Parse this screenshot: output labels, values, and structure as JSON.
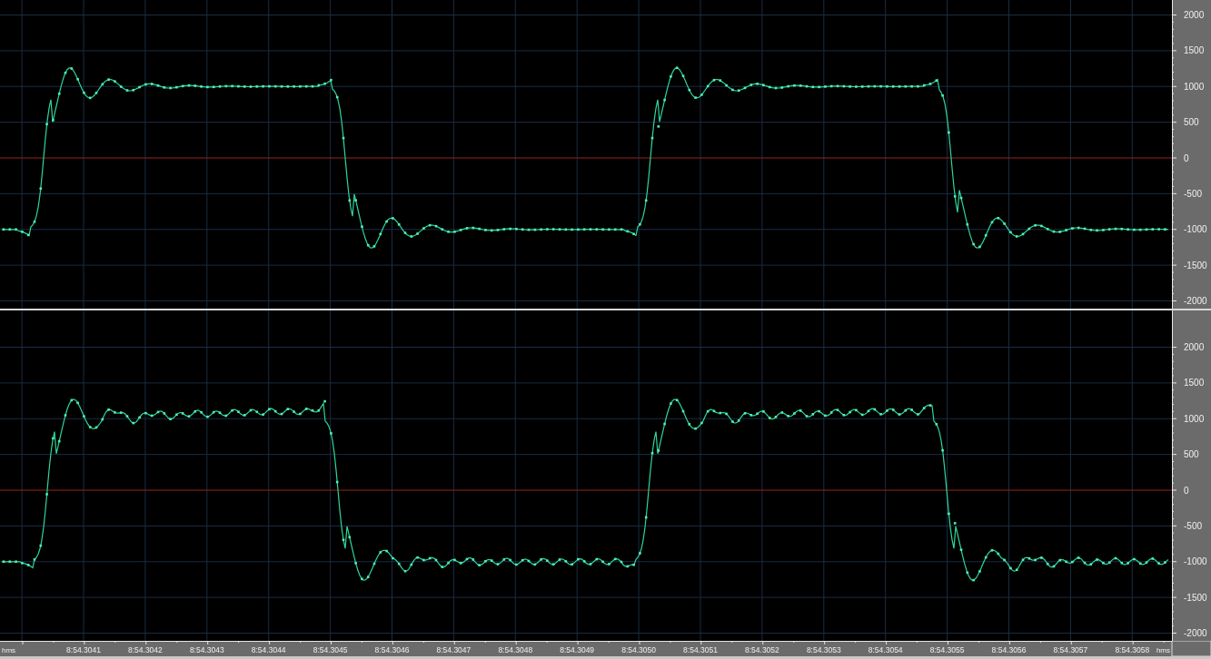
{
  "channels": [
    {
      "y_ticks": [
        "2000",
        "1500",
        "1000",
        "500",
        "0",
        "-500",
        "-1000",
        "-1500",
        "-2000"
      ]
    },
    {
      "y_ticks": [
        "2000",
        "1500",
        "1000",
        "500",
        "0",
        "-500",
        "-1000",
        "-1500",
        "-2000"
      ]
    }
  ],
  "time_ruler": {
    "unit_left": "hms",
    "unit_right": "hms",
    "ticks": [
      "8:54.3041",
      "8:54.3042",
      "8:54.3043",
      "8:54.3044",
      "8:54.3045",
      "8:54.3046",
      "8:54.3047",
      "8:54.3048",
      "8:54.3049",
      "8:54.3050",
      "8:54.3051",
      "8:54.3052",
      "8:54.3053",
      "8:54.3054",
      "8:54.3055",
      "8:54.3056",
      "8:54.3057",
      "8:54.3058"
    ]
  }
}
